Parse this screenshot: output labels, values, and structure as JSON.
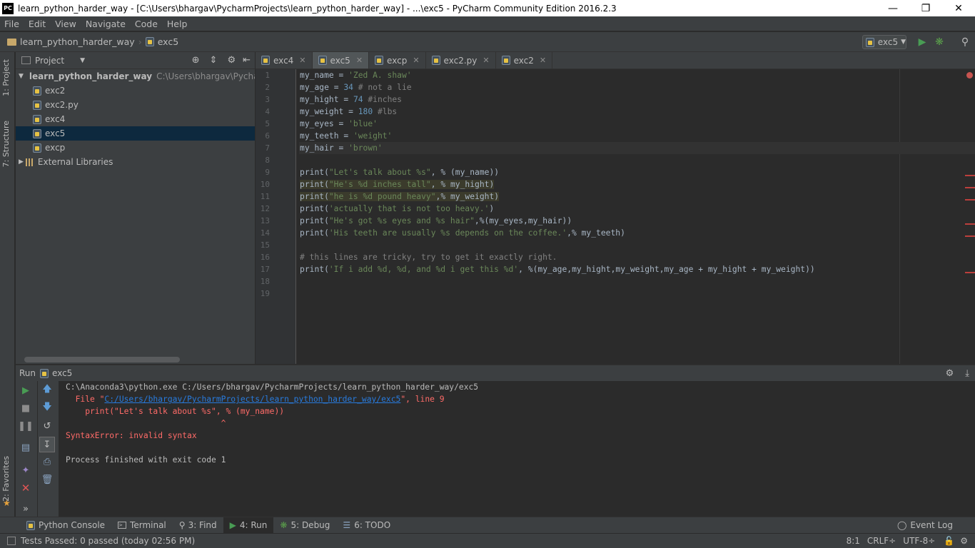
{
  "window": {
    "title": "learn_python_harder_way - [C:\\Users\\bhargav\\PycharmProjects\\learn_python_harder_way] - ...\\exc5 - PyCharm Community Edition 2016.2.3",
    "app_icon": "PC"
  },
  "menu": [
    "File",
    "Edit",
    "View",
    "Navigate",
    "Code",
    "Help"
  ],
  "breadcrumb": {
    "project": "learn_python_harder_way",
    "file": "exc5"
  },
  "run_config": {
    "name": "exc5"
  },
  "left_strip": {
    "project_tab": "1: Project",
    "structure_tab": "7: Structure",
    "favorites_tab": "2: Favorites"
  },
  "project_panel": {
    "header": "Project",
    "root": "learn_python_harder_way",
    "root_path": "C:\\Users\\bhargav\\PycharmProjects\\learn_python_harder_way",
    "files": [
      "exc2",
      "exc2.py",
      "exc4",
      "exc5",
      "excp"
    ],
    "selected": "exc5",
    "external": "External Libraries"
  },
  "editor_tabs": [
    "exc4",
    "exc5",
    "excp",
    "exc2.py",
    "exc2"
  ],
  "active_tab": "exc5",
  "line_numbers": [
    "1",
    "2",
    "3",
    "4",
    "5",
    "6",
    "7",
    "8",
    "9",
    "10",
    "11",
    "12",
    "13",
    "14",
    "15",
    "16",
    "17",
    "18",
    "19"
  ],
  "code_lines": [
    "my_name = 'Zed A. shaw'",
    "my_age = 34 # not a lie",
    "my_hight = 74 #inches",
    "my_weight = 180 #lbs",
    "my_eyes = 'blue'",
    "my_teeth = 'weight'",
    "my_hair = 'brown'",
    "",
    "print(\"Let's talk about %s\", % (my_name))",
    "print(\"He's %d inches tall\", % my_hight)",
    "print(\"he is %d pound heavy\",% my_weight)",
    "print('actually that is not too heavy.')",
    "print(\"He's got %s eyes and %s hair\",%(my_eyes,my_hair))",
    "print('His teeth are usually %s depends on the coffee.',% my_teeth)",
    "",
    "# this lines are tricky, try to get it exactly right.",
    "print('If i add %d, %d, and %d i get this %d', %(my_age,my_hight,my_weight,my_age + my_hight + my_weight))",
    "",
    ""
  ],
  "run_panel": {
    "label": "Run",
    "config": "exc5",
    "output": [
      "C:\\Anaconda3\\python.exe C:/Users/bhargav/PycharmProjects/learn_python_harder_way/exc5",
      "  File \"C:/Users/bhargav/PycharmProjects/learn_python_harder_way/exc5\", line 9",
      "    print(\"Let's talk about %s\", % (my_name))",
      "                                ^",
      "SyntaxError: invalid syntax",
      "",
      "Process finished with exit code 1"
    ],
    "file_link": "C:/Users/bhargav/PycharmProjects/learn_python_harder_way/exc5"
  },
  "bottom_tabs": [
    "Python Console",
    "Terminal",
    "3: Find",
    "4: Run",
    "5: Debug",
    "6: TODO"
  ],
  "event_log": "Event Log",
  "status": {
    "message": "Tests Passed: 0 passed (today 02:56 PM)",
    "position": "8:1",
    "line_sep": "CRLF÷",
    "encoding": "UTF-8÷"
  },
  "colors": {
    "error": "#bc3f3c",
    "string": "#6a8759",
    "comment": "#808080",
    "number": "#6897bb",
    "link": "#287bde",
    "run_green": "#499c54"
  }
}
